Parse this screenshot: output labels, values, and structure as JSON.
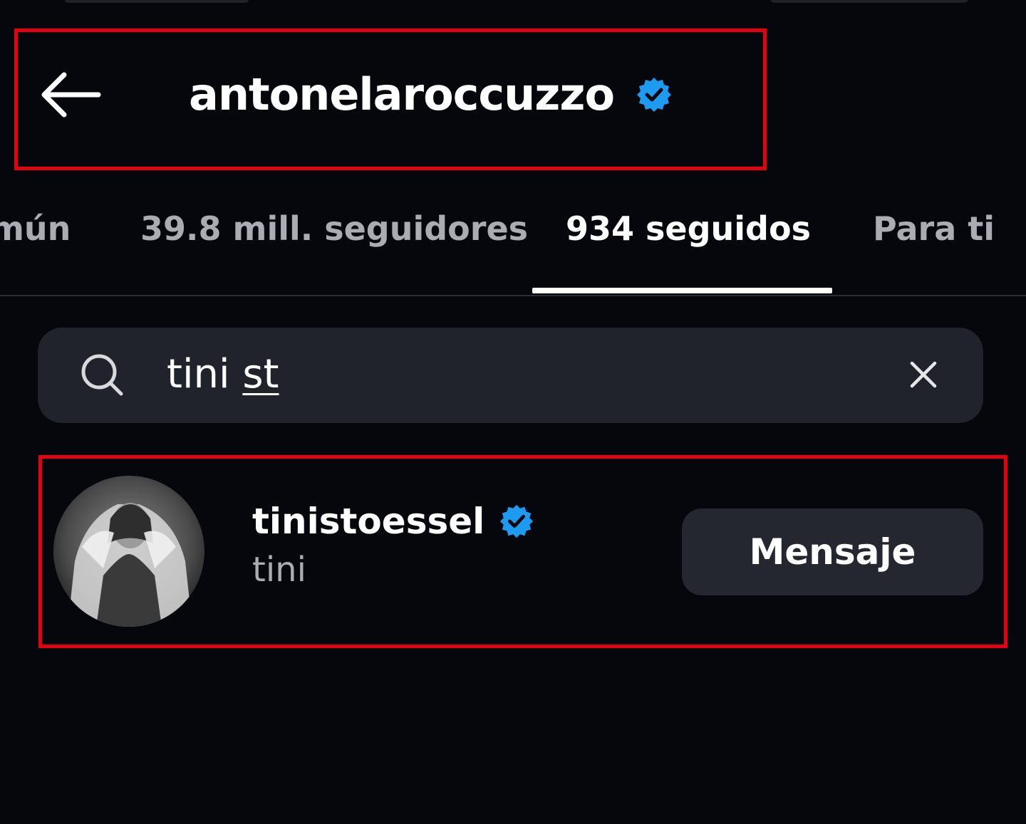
{
  "header": {
    "title": "antonelaroccuzzo",
    "back_icon": "arrow-left-icon",
    "verified_icon": "verified-badge-icon"
  },
  "tabs": [
    {
      "label": "mún",
      "active": false
    },
    {
      "label": "39.8 mill. seguidores",
      "active": false
    },
    {
      "label": "934 seguidos",
      "active": true
    },
    {
      "label": "Para ti",
      "active": false
    }
  ],
  "search": {
    "value_plain": "tini ",
    "value_composing": "st",
    "icon": "search-icon",
    "clear_icon": "close-icon"
  },
  "results": [
    {
      "username": "tinistoessel",
      "display_name": "tini",
      "verified": true,
      "action_label": "Mensaje"
    }
  ],
  "colors": {
    "background": "#05070d",
    "highlight": "#e4000f",
    "verified": "#1d9bf0",
    "muted_text": "#a9acb3",
    "surface": "#20232b"
  }
}
